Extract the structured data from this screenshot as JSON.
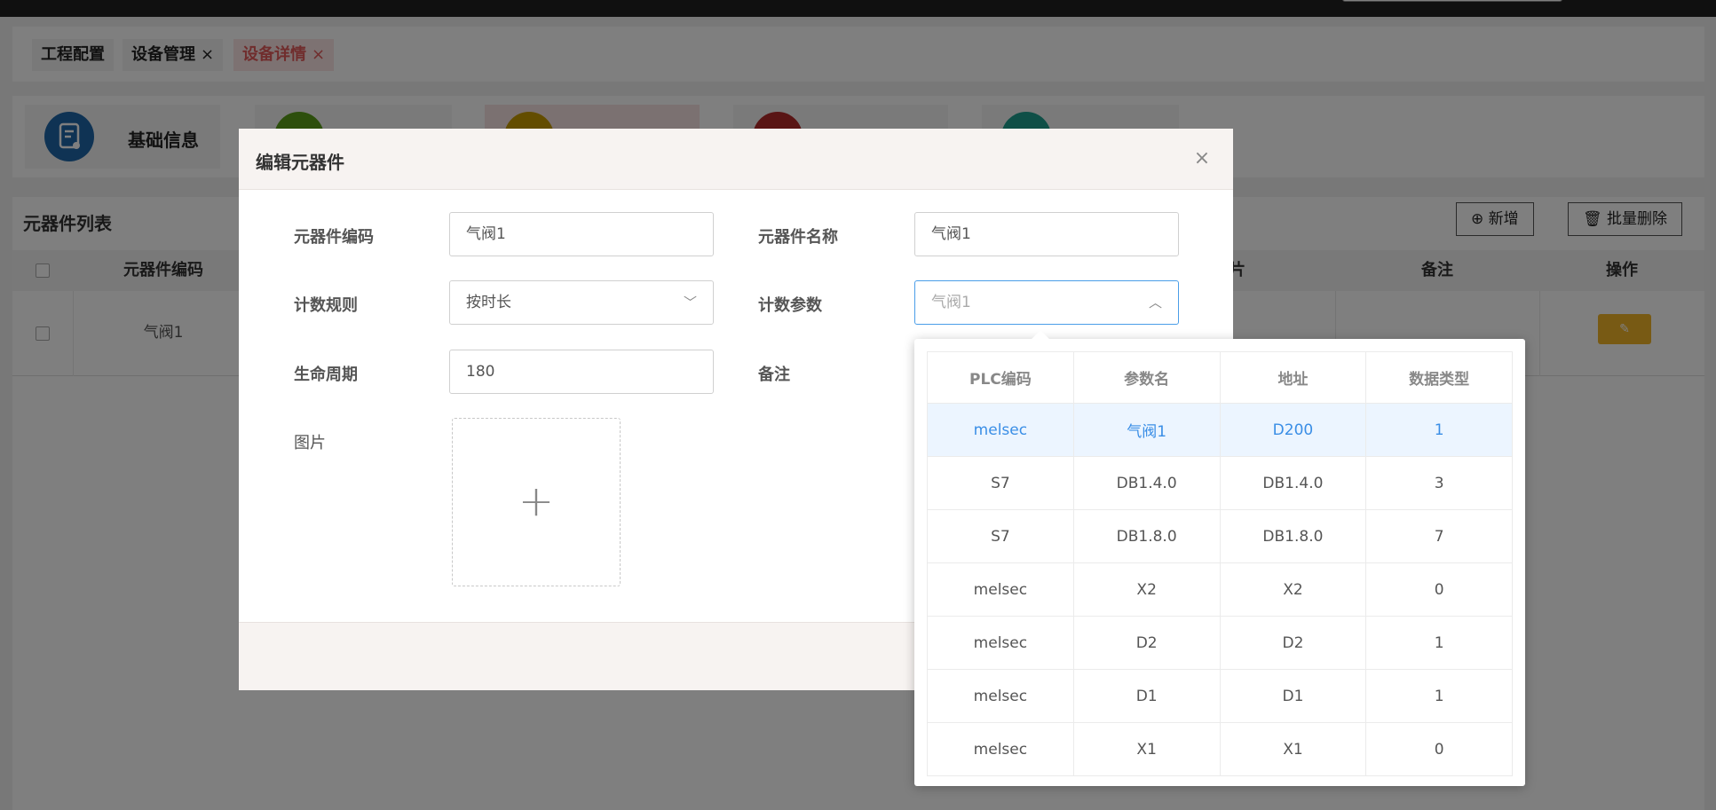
{
  "tags": [
    {
      "label": "工程配置",
      "close": ""
    },
    {
      "label": "设备管理",
      "close": "×"
    },
    {
      "label": "设备详情",
      "close": "×"
    }
  ],
  "cards": [
    {
      "label": "基础信息",
      "icon": "document-icon",
      "color": "#1f67a8"
    },
    {
      "label": "",
      "icon": "gear-icon",
      "color": "#5a9e1a"
    },
    {
      "label": "",
      "icon": "gauge-icon",
      "color": "#c79a00"
    },
    {
      "label": "",
      "icon": "home-icon",
      "color": "#b22b2b"
    },
    {
      "label": "",
      "icon": "book-icon",
      "color": "#1e9e8e"
    }
  ],
  "list": {
    "title": "元器件列表",
    "add_label": "新增",
    "batch_delete_label": "批量删除",
    "headers": {
      "code": "元器件编码",
      "image": "片",
      "remark": "备注",
      "action": "操作"
    },
    "rows": [
      {
        "code": "气阀1"
      }
    ]
  },
  "dialog": {
    "title": "编辑元器件",
    "close": "×",
    "fields": {
      "code_label": "元器件编码",
      "code_value": "气阀1",
      "name_label": "元器件名称",
      "name_value": "气阀1",
      "rule_label": "计数规则",
      "rule_value": "按时长",
      "param_label": "计数参数",
      "param_placeholder": "气阀1",
      "life_label": "生命周期",
      "life_value": "180",
      "remark_label": "备注",
      "image_label": "图片"
    }
  },
  "dropdown": {
    "headers": [
      "PLC编码",
      "参数名",
      "地址",
      "数据类型"
    ],
    "rows": [
      [
        "melsec",
        "气阀1",
        "D200",
        "1"
      ],
      [
        "S7",
        "DB1.4.0",
        "DB1.4.0",
        "3"
      ],
      [
        "S7",
        "DB1.8.0",
        "DB1.8.0",
        "7"
      ],
      [
        "melsec",
        "X2",
        "X2",
        "0"
      ],
      [
        "melsec",
        "D2",
        "D2",
        "1"
      ],
      [
        "melsec",
        "D1",
        "D1",
        "1"
      ],
      [
        "melsec",
        "X1",
        "X1",
        "0"
      ]
    ],
    "selected_index": 0,
    "selected_color": "#3a8ee6"
  }
}
